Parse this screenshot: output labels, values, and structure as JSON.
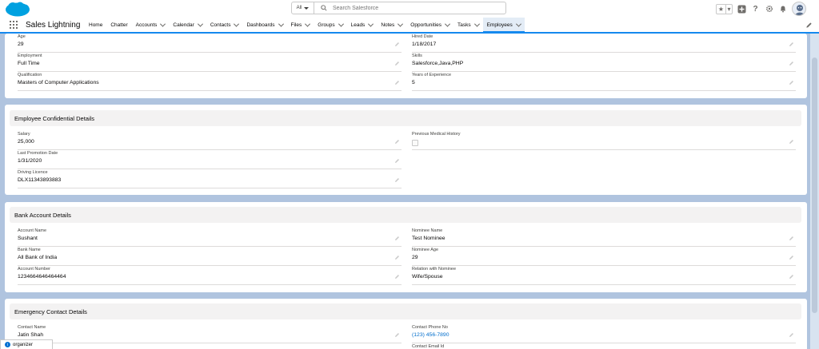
{
  "header": {
    "search_scope": "All",
    "search_placeholder": "Search Salesforce",
    "icons": [
      "salesforce-cloud-logo",
      "favorites-star-icon",
      "add-icon",
      "help-icon",
      "gear-icon",
      "bell-icon",
      "avatar"
    ]
  },
  "nav": {
    "app_name": "Sales Lightning",
    "items": [
      {
        "label": "Home",
        "has_menu": false
      },
      {
        "label": "Chatter",
        "has_menu": false
      },
      {
        "label": "Accounts",
        "has_menu": true
      },
      {
        "label": "Calendar",
        "has_menu": true
      },
      {
        "label": "Contacts",
        "has_menu": true
      },
      {
        "label": "Dashboards",
        "has_menu": true
      },
      {
        "label": "Files",
        "has_menu": true
      },
      {
        "label": "Groups",
        "has_menu": true
      },
      {
        "label": "Leads",
        "has_menu": true
      },
      {
        "label": "Notes",
        "has_menu": true
      },
      {
        "label": "Opportunities",
        "has_menu": true
      },
      {
        "label": "Tasks",
        "has_menu": true
      },
      {
        "label": "Employees",
        "has_menu": true,
        "active": true
      }
    ]
  },
  "details": {
    "age_label": "Age",
    "age_value": "29",
    "hired_label": "Hired Date",
    "hired_value": "1/18/2017",
    "employment_label": "Employment",
    "employment_value": "Full Time",
    "skills_label": "Skills",
    "skills_value": "Salesforce,Java,PHP",
    "qualification_label": "Qualification",
    "qualification_value": "Masters of Computer Applications",
    "experience_label": "Years of Experience",
    "experience_value": "5"
  },
  "confidential": {
    "title": "Employee Confidential Details",
    "salary_label": "Salary",
    "salary_value": "25,000",
    "medical_label": "Previous Medical History",
    "medical_checked": false,
    "promotion_label": "Last Promotion Date",
    "promotion_value": "1/31/2020",
    "licence_label": "Driving Licence",
    "licence_value": "DLX11343893883"
  },
  "bank": {
    "title": "Bank Account Details",
    "account_name_label": "Account Name",
    "account_name_value": "Sushant",
    "nominee_name_label": "Nominee Name",
    "nominee_name_value": "Test Nominee",
    "bank_name_label": "Bank Name",
    "bank_name_value": "All Bank of India",
    "nominee_age_label": "Nominee Age",
    "nominee_age_value": "29",
    "account_number_label": "Account Number",
    "account_number_value": "1234664646464464",
    "relation_label": "Relation with Nominee",
    "relation_value": "Wife/Spouse"
  },
  "emergency": {
    "title": "Emergency Contact Details",
    "contact_name_label": "Contact Name",
    "contact_name_value": "Jatin Shah",
    "phone_label": "Contact Phone No",
    "phone_value": "(123) 456-7890",
    "email_label": "Contact Email Id"
  },
  "utility_bar": {
    "label": "organizer"
  },
  "colors": {
    "brand": "#1589ee",
    "page_bg": "#b0c4df",
    "link": "#006dcc"
  }
}
